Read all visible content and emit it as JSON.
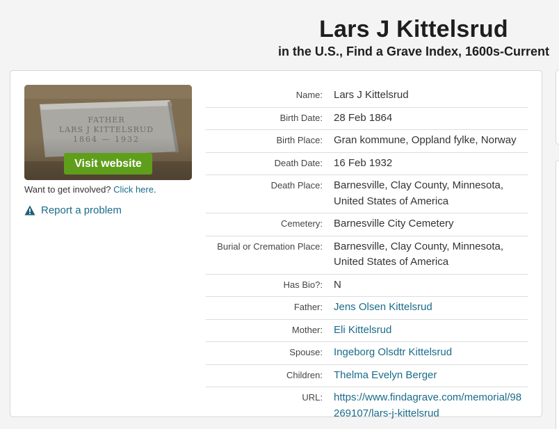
{
  "header": {
    "title": "Lars J Kittelsrud",
    "subtitle": "in the U.S., Find a Grave Index, 1600s-Current"
  },
  "sidebar": {
    "visit_label": "Visit website",
    "involved_text": "Want to get involved?",
    "involved_link": "Click here",
    "involved_period": ".",
    "report_label": "Report a problem",
    "thumbnail_icon": "gravestone-photo"
  },
  "details": {
    "rows": [
      {
        "label": "Name:",
        "value": "Lars J Kittelsrud",
        "link": false
      },
      {
        "label": "Birth Date:",
        "value": "28 Feb 1864",
        "link": false
      },
      {
        "label": "Birth Place:",
        "value": "Gran kommune, Oppland fylke, Norway",
        "link": false
      },
      {
        "label": "Death Date:",
        "value": "16 Feb 1932",
        "link": false
      },
      {
        "label": "Death Place:",
        "value": "Barnesville, Clay County, Minnesota, United States of America",
        "link": false
      },
      {
        "label": "Cemetery:",
        "value": "Barnesville City Cemetery",
        "link": false
      },
      {
        "label": "Burial or Cremation Place:",
        "value": "Barnesville, Clay County, Minnesota, United States of America",
        "link": false
      },
      {
        "label": "Has Bio?:",
        "value": "N",
        "link": false
      },
      {
        "label": "Father:",
        "value": "Jens Olsen Kittelsrud",
        "link": true
      },
      {
        "label": "Mother:",
        "value": "Eli Kittelsrud",
        "link": true
      },
      {
        "label": "Spouse:",
        "value": "Ingeborg Olsdtr Kittelsrud",
        "link": true
      },
      {
        "label": "Children:",
        "value": "Thelma Evelyn Berger",
        "link": true
      },
      {
        "label": "URL:",
        "value": "https://www.findagrave.com/memorial/98269107/lars-j-kittelsrud",
        "link": true
      }
    ]
  },
  "colors": {
    "link": "#1a6b8a",
    "button_green": "#5f9e1a",
    "page_bg": "#f4f4f4"
  }
}
